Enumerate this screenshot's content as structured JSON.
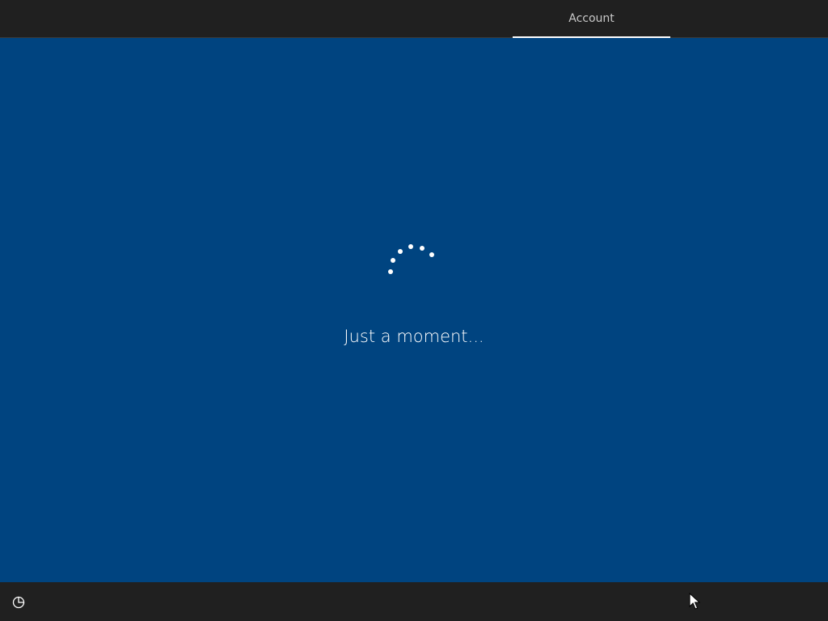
{
  "header": {
    "tabs": [
      {
        "label": "Account",
        "active": true
      }
    ]
  },
  "main": {
    "status_text": "Just a moment...",
    "spinner_icon": "loading-dots-spinner"
  },
  "footer": {
    "ease_of_access_icon": "ease-of-access-icon"
  },
  "colors": {
    "background": "#004480",
    "bars": "#202020",
    "text": "#ffffff",
    "tab_text": "#c8c8c8"
  }
}
